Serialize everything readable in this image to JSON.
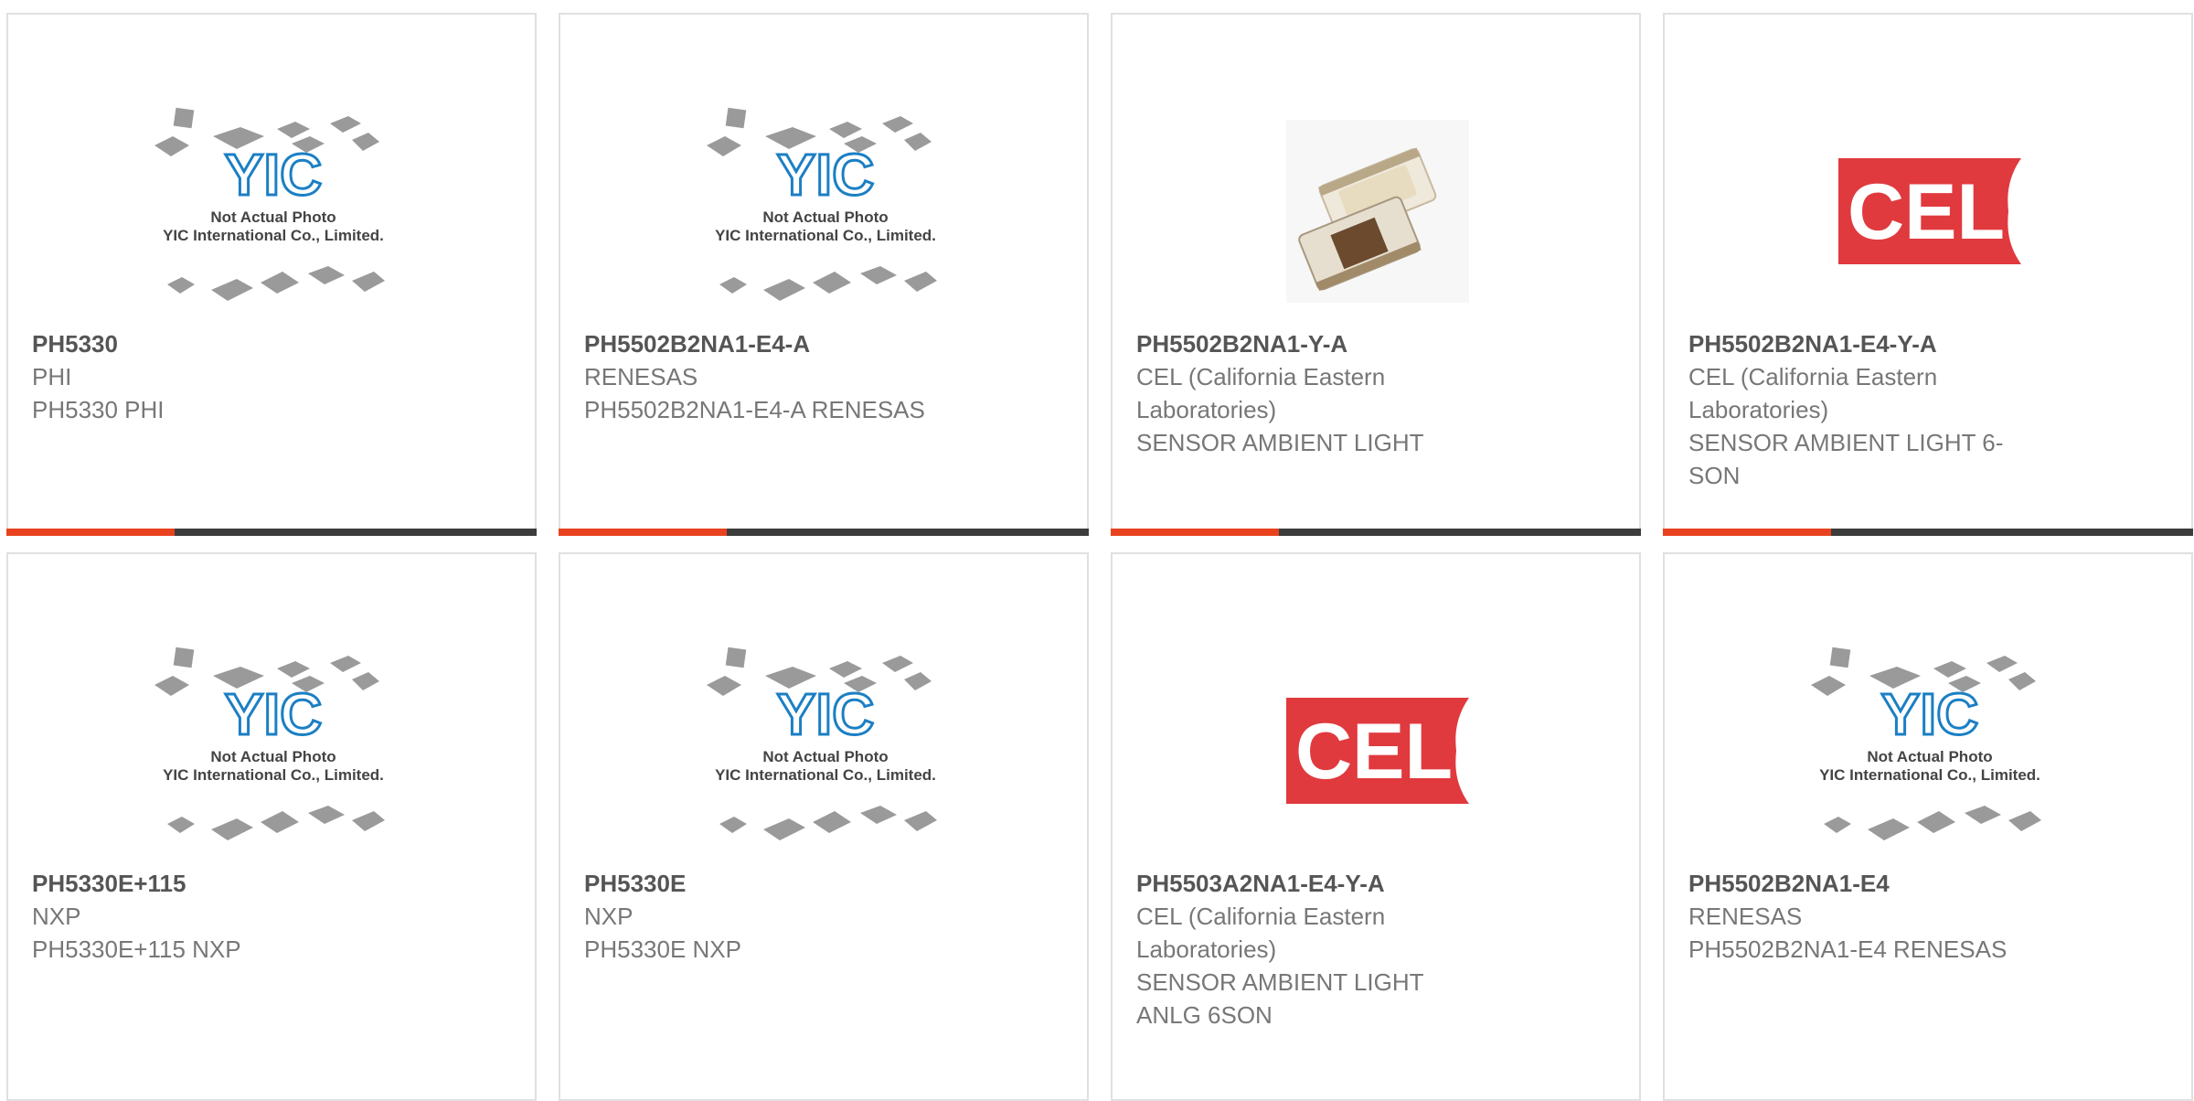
{
  "placeholder": {
    "brand": "YIC",
    "line1": "Not Actual Photo",
    "line2": "YIC International Co., Limited."
  },
  "cel_logo": {
    "text": "CEL",
    "color": "#e03a3e"
  },
  "colors": {
    "accent": "#e8421f",
    "bar": "#3c3c3c",
    "brand_blue": "#1b7fc4"
  },
  "products": [
    {
      "part": "PH5330",
      "maker": "PHI",
      "desc": "PH5330 PHI",
      "image": "placeholder"
    },
    {
      "part": "PH5502B2NA1-E4-A",
      "maker": "RENESAS",
      "desc": "PH5502B2NA1-E4-A RENESAS",
      "image": "placeholder"
    },
    {
      "part": "PH5502B2NA1-Y-A",
      "maker": "CEL (California Eastern Laboratories)",
      "desc": "SENSOR AMBIENT LIGHT",
      "image": "photo"
    },
    {
      "part": "PH5502B2NA1-E4-Y-A",
      "maker": "CEL (California Eastern Laboratories)",
      "desc": "SENSOR AMBIENT LIGHT 6-SON",
      "image": "cel-logo"
    },
    {
      "part": "PH5330E+115",
      "maker": "NXP",
      "desc": "PH5330E+115 NXP",
      "image": "placeholder"
    },
    {
      "part": "PH5330E",
      "maker": "NXP",
      "desc": "PH5330E NXP",
      "image": "placeholder"
    },
    {
      "part": "PH5503A2NA1-E4-Y-A",
      "maker": "CEL (California Eastern Laboratories)",
      "desc": "SENSOR AMBIENT LIGHT ANLG 6SON",
      "image": "cel-logo"
    },
    {
      "part": "PH5502B2NA1-E4",
      "maker": "RENESAS",
      "desc": "PH5502B2NA1-E4 RENESAS",
      "image": "placeholder"
    }
  ]
}
